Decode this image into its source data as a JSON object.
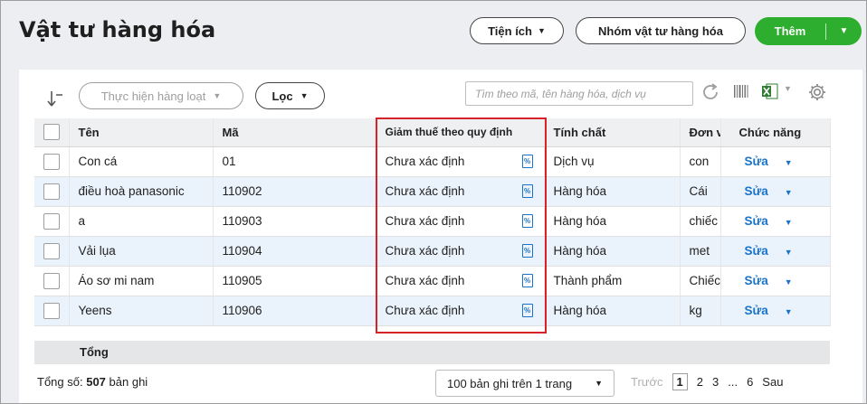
{
  "header": {
    "title": "Vật tư hàng hóa",
    "utility_label": "Tiện ích",
    "group_label": "Nhóm vật tư hàng hóa",
    "add_label": "Thêm"
  },
  "toolbar": {
    "bulk_action_label": "Thực hiện hàng loạt",
    "filter_label": "Lọc",
    "search_placeholder": "Tìm theo mã, tên hàng hóa, dịch vụ"
  },
  "table": {
    "columns": [
      "Tên",
      "Mã",
      "Giảm thuế theo quy định",
      "Tính chất",
      "Đơn vị",
      "Chức năng"
    ],
    "rows": [
      {
        "name": "Con cá",
        "code": "01",
        "tax": "Chưa xác định",
        "kind": "Dịch vụ",
        "unit": "con",
        "action": "Sửa"
      },
      {
        "name": "điều hoà panasonic",
        "code": "110902",
        "tax": "Chưa xác định",
        "kind": "Hàng hóa",
        "unit": "Cái",
        "action": "Sửa"
      },
      {
        "name": "a",
        "code": "110903",
        "tax": "Chưa xác định",
        "kind": "Hàng hóa",
        "unit": "chiếc",
        "action": "Sửa"
      },
      {
        "name": "Vải lụa",
        "code": "110904",
        "tax": "Chưa xác định",
        "kind": "Hàng hóa",
        "unit": "met",
        "action": "Sửa"
      },
      {
        "name": "Áo sơ mi nam",
        "code": "110905",
        "tax": "Chưa xác định",
        "kind": "Thành phẩm",
        "unit": "Chiếc",
        "action": "Sửa"
      },
      {
        "name": "Yeens",
        "code": "110906",
        "tax": "Chưa xác định",
        "kind": "Hàng hóa",
        "unit": "kg",
        "action": "Sửa"
      }
    ],
    "total_label": "Tổng"
  },
  "footer": {
    "count_prefix": "Tổng số:",
    "count_value": "507",
    "count_suffix": "bản ghi",
    "page_size_label": "100 bản ghi trên 1 trang",
    "prev_label": "Trước",
    "pages": [
      "1",
      "2",
      "3",
      "...",
      "6"
    ],
    "next_label": "Sau"
  },
  "colors": {
    "primary_button": "#2eae2e",
    "link": "#1a73c8",
    "highlight_border": "#d6232a",
    "alt_row": "#eaf3fc"
  },
  "icons": [
    "sort-down-icon",
    "refresh-icon",
    "barcode-icon",
    "excel-icon",
    "gear-icon",
    "percent-doc-icon",
    "chevron-down-icon"
  ]
}
